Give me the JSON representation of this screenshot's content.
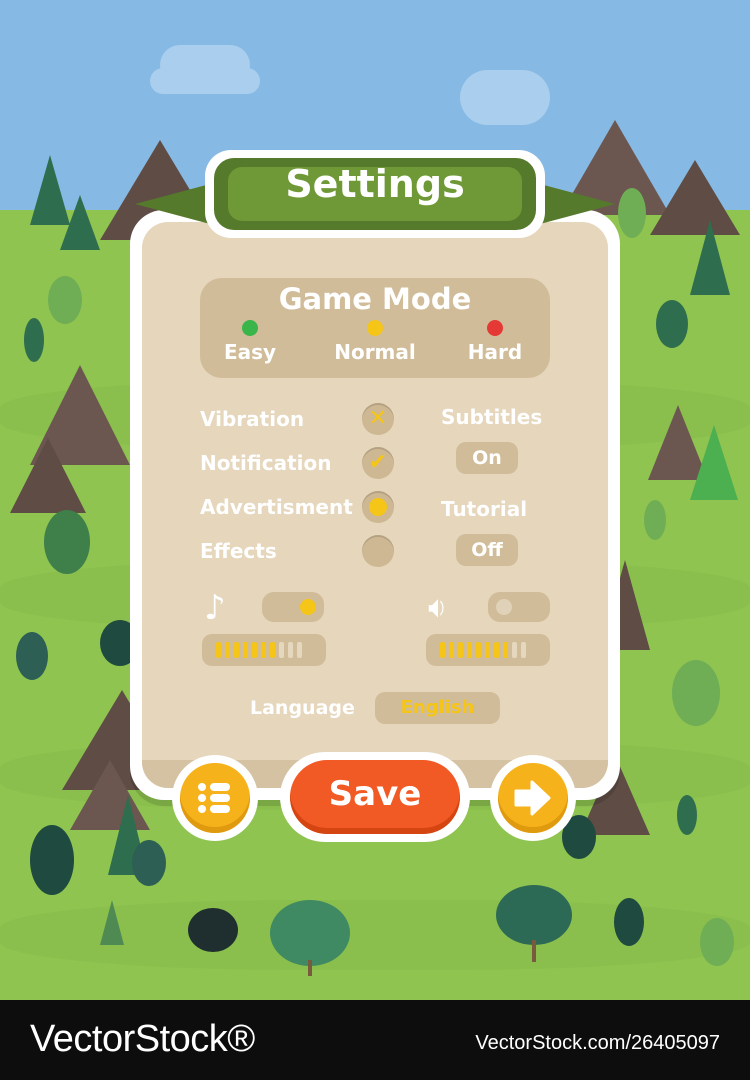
{
  "title": "Settings",
  "game_mode": {
    "title": "Game Mode",
    "options": [
      {
        "label": "Easy",
        "color": "#39b54a"
      },
      {
        "label": "Normal",
        "color": "#f5c518"
      },
      {
        "label": "Hard",
        "color": "#e53935"
      }
    ]
  },
  "options_left": [
    {
      "label": "Vibration",
      "state": "x"
    },
    {
      "label": "Notification",
      "state": "check"
    },
    {
      "label": "Advertisment",
      "state": "dot"
    },
    {
      "label": "Effects",
      "state": "empty"
    }
  ],
  "options_right": [
    {
      "label": "Subtitles",
      "value": "On"
    },
    {
      "label": "Tutorial",
      "value": "Off"
    }
  ],
  "audio": {
    "music": {
      "icon": "music-note-icon",
      "toggle_on": true,
      "level_segments": 10,
      "active_segments": 7
    },
    "sound": {
      "icon": "speaker-icon",
      "toggle_on": false,
      "level_segments": 10,
      "active_segments": 8
    }
  },
  "language": {
    "label": "Language",
    "value": "English"
  },
  "buttons": {
    "menu_icon": "menu-list-icon",
    "save": "Save",
    "next_icon": "arrow-right-icon"
  },
  "colors": {
    "accent_yellow": "#f5c518",
    "save_orange": "#f15a24",
    "banner_green": "#567a2b",
    "panel_beige": "#e5d6bc"
  },
  "watermark": {
    "left": "VectorStock®",
    "right": "VectorStock.com/26405097"
  }
}
